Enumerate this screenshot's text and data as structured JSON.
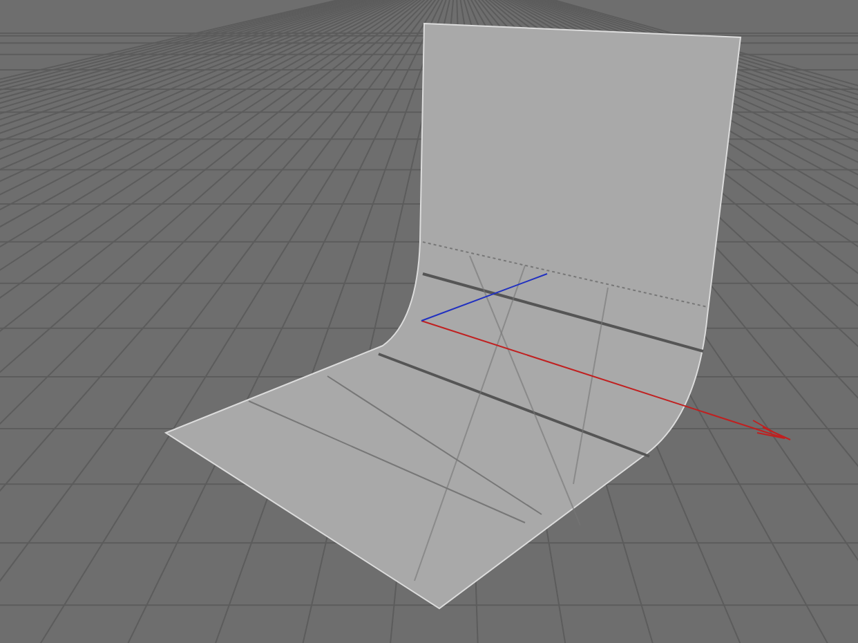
{
  "viewport": {
    "axes": [
      {
        "kind": "x"
      },
      {
        "kind": "z"
      }
    ]
  }
}
